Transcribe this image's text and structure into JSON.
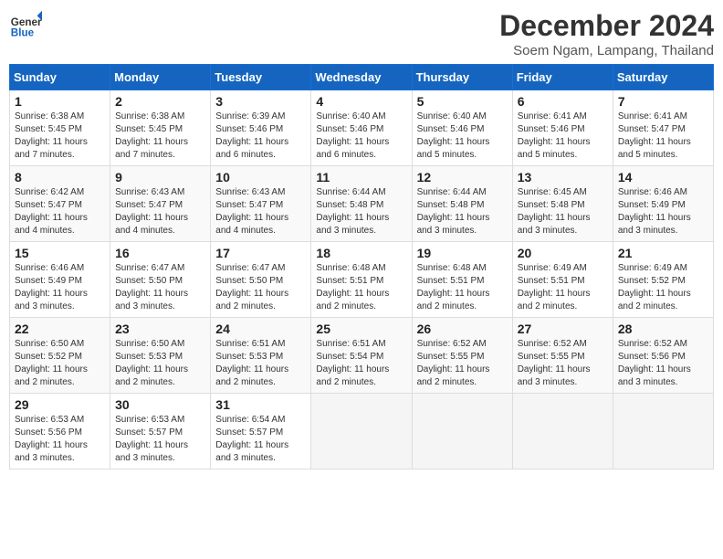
{
  "header": {
    "logo_general": "General",
    "logo_blue": "Blue",
    "month_year": "December 2024",
    "location": "Soem Ngam, Lampang, Thailand"
  },
  "weekdays": [
    "Sunday",
    "Monday",
    "Tuesday",
    "Wednesday",
    "Thursday",
    "Friday",
    "Saturday"
  ],
  "weeks": [
    [
      {
        "day": "1",
        "sunrise": "6:38 AM",
        "sunset": "5:45 PM",
        "daylight": "11 hours and 7 minutes."
      },
      {
        "day": "2",
        "sunrise": "6:38 AM",
        "sunset": "5:45 PM",
        "daylight": "11 hours and 7 minutes."
      },
      {
        "day": "3",
        "sunrise": "6:39 AM",
        "sunset": "5:46 PM",
        "daylight": "11 hours and 6 minutes."
      },
      {
        "day": "4",
        "sunrise": "6:40 AM",
        "sunset": "5:46 PM",
        "daylight": "11 hours and 6 minutes."
      },
      {
        "day": "5",
        "sunrise": "6:40 AM",
        "sunset": "5:46 PM",
        "daylight": "11 hours and 5 minutes."
      },
      {
        "day": "6",
        "sunrise": "6:41 AM",
        "sunset": "5:46 PM",
        "daylight": "11 hours and 5 minutes."
      },
      {
        "day": "7",
        "sunrise": "6:41 AM",
        "sunset": "5:47 PM",
        "daylight": "11 hours and 5 minutes."
      }
    ],
    [
      {
        "day": "8",
        "sunrise": "6:42 AM",
        "sunset": "5:47 PM",
        "daylight": "11 hours and 4 minutes."
      },
      {
        "day": "9",
        "sunrise": "6:43 AM",
        "sunset": "5:47 PM",
        "daylight": "11 hours and 4 minutes."
      },
      {
        "day": "10",
        "sunrise": "6:43 AM",
        "sunset": "5:47 PM",
        "daylight": "11 hours and 4 minutes."
      },
      {
        "day": "11",
        "sunrise": "6:44 AM",
        "sunset": "5:48 PM",
        "daylight": "11 hours and 3 minutes."
      },
      {
        "day": "12",
        "sunrise": "6:44 AM",
        "sunset": "5:48 PM",
        "daylight": "11 hours and 3 minutes."
      },
      {
        "day": "13",
        "sunrise": "6:45 AM",
        "sunset": "5:48 PM",
        "daylight": "11 hours and 3 minutes."
      },
      {
        "day": "14",
        "sunrise": "6:46 AM",
        "sunset": "5:49 PM",
        "daylight": "11 hours and 3 minutes."
      }
    ],
    [
      {
        "day": "15",
        "sunrise": "6:46 AM",
        "sunset": "5:49 PM",
        "daylight": "11 hours and 3 minutes."
      },
      {
        "day": "16",
        "sunrise": "6:47 AM",
        "sunset": "5:50 PM",
        "daylight": "11 hours and 3 minutes."
      },
      {
        "day": "17",
        "sunrise": "6:47 AM",
        "sunset": "5:50 PM",
        "daylight": "11 hours and 2 minutes."
      },
      {
        "day": "18",
        "sunrise": "6:48 AM",
        "sunset": "5:51 PM",
        "daylight": "11 hours and 2 minutes."
      },
      {
        "day": "19",
        "sunrise": "6:48 AM",
        "sunset": "5:51 PM",
        "daylight": "11 hours and 2 minutes."
      },
      {
        "day": "20",
        "sunrise": "6:49 AM",
        "sunset": "5:51 PM",
        "daylight": "11 hours and 2 minutes."
      },
      {
        "day": "21",
        "sunrise": "6:49 AM",
        "sunset": "5:52 PM",
        "daylight": "11 hours and 2 minutes."
      }
    ],
    [
      {
        "day": "22",
        "sunrise": "6:50 AM",
        "sunset": "5:52 PM",
        "daylight": "11 hours and 2 minutes."
      },
      {
        "day": "23",
        "sunrise": "6:50 AM",
        "sunset": "5:53 PM",
        "daylight": "11 hours and 2 minutes."
      },
      {
        "day": "24",
        "sunrise": "6:51 AM",
        "sunset": "5:53 PM",
        "daylight": "11 hours and 2 minutes."
      },
      {
        "day": "25",
        "sunrise": "6:51 AM",
        "sunset": "5:54 PM",
        "daylight": "11 hours and 2 minutes."
      },
      {
        "day": "26",
        "sunrise": "6:52 AM",
        "sunset": "5:55 PM",
        "daylight": "11 hours and 2 minutes."
      },
      {
        "day": "27",
        "sunrise": "6:52 AM",
        "sunset": "5:55 PM",
        "daylight": "11 hours and 3 minutes."
      },
      {
        "day": "28",
        "sunrise": "6:52 AM",
        "sunset": "5:56 PM",
        "daylight": "11 hours and 3 minutes."
      }
    ],
    [
      {
        "day": "29",
        "sunrise": "6:53 AM",
        "sunset": "5:56 PM",
        "daylight": "11 hours and 3 minutes."
      },
      {
        "day": "30",
        "sunrise": "6:53 AM",
        "sunset": "5:57 PM",
        "daylight": "11 hours and 3 minutes."
      },
      {
        "day": "31",
        "sunrise": "6:54 AM",
        "sunset": "5:57 PM",
        "daylight": "11 hours and 3 minutes."
      },
      null,
      null,
      null,
      null
    ]
  ],
  "labels": {
    "sunrise": "Sunrise:",
    "sunset": "Sunset:",
    "daylight": "Daylight:"
  }
}
